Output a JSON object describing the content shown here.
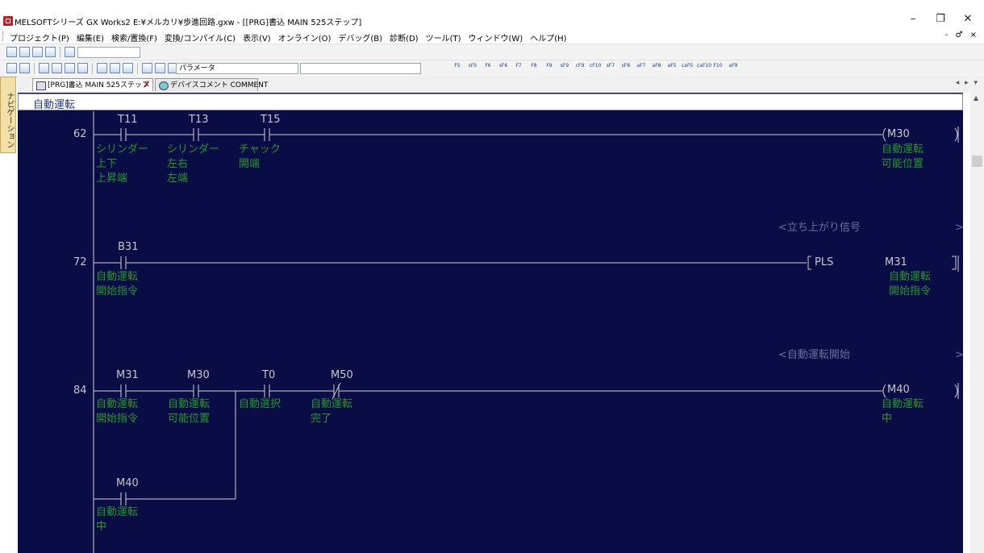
{
  "window": {
    "title": "MELSOFTシリーズ GX Works2 E:¥メルカリ¥歩進回路.gxw - [[PRG]書込 MAIN 525ステップ]",
    "controls": [
      "–",
      "❐",
      "✕"
    ]
  },
  "menu": {
    "items": [
      "プロジェクト(P)",
      "編集(E)",
      "検索/置換(F)",
      "変換/コンパイル(C)",
      "表示(V)",
      "オンライン(O)",
      "デバッグ(B)",
      "診断(D)",
      "ツール(T)",
      "ウィンドウ(W)",
      "ヘルプ(H)"
    ],
    "mdi_controls": "- ♂ ×"
  },
  "toolbar2": {
    "param_combo": "パラメータ"
  },
  "fkeys": [
    "F5",
    "sF5",
    "F6",
    "sF6",
    "F7",
    "F8",
    "F9",
    "sF9",
    "cF9",
    "cF10",
    "sF7",
    "sF8",
    "aF7",
    "aF8",
    "aF5",
    "caF5",
    "caF10",
    "F10",
    "aF9"
  ],
  "navigation": {
    "label": "ナビゲーション"
  },
  "tabs": [
    {
      "label": "[PRG]書込 MAIN 525ステップ",
      "active": true,
      "close": "✕"
    },
    {
      "label": "デバイスコメント COMMENT",
      "active": false
    }
  ],
  "tab_nav": "◂ ▸ ▾",
  "ladder": {
    "header_comment": "自動運転",
    "rungs": [
      {
        "step": "62",
        "contacts": [
          {
            "device": "T11",
            "comment": [
              "シリンダー",
              "上下",
              "上昇端"
            ]
          },
          {
            "device": "T13",
            "comment": [
              "シリンダー",
              "左右",
              "左端"
            ]
          },
          {
            "device": "T15",
            "comment": [
              "チャック",
              "開端"
            ]
          }
        ],
        "coil": {
          "device": "M30",
          "comment": [
            "自動運転",
            "可能位置"
          ]
        }
      },
      {
        "note": "<立ち上がり信号",
        "step": "72",
        "contacts": [
          {
            "device": "B31",
            "comment": [
              "自動運転",
              "開始指令"
            ]
          }
        ],
        "instruction": {
          "name": "PLS",
          "device": "M31",
          "comment": [
            "自動運転",
            "開始指令"
          ]
        }
      },
      {
        "note": "<自動運転開始",
        "step": "84",
        "contacts": [
          {
            "device": "M31",
            "comment": [
              "自動運転",
              "開始指令"
            ]
          },
          {
            "device": "M30",
            "comment": [
              "自動運転",
              "可能位置"
            ]
          },
          {
            "device": "T0",
            "comment": [
              "自動選択"
            ]
          },
          {
            "device": "M50",
            "comment": [
              "自動運転",
              "完了"
            ],
            "normally_closed": true
          }
        ],
        "branch": {
          "device": "M40",
          "comment": [
            "自動運転",
            "中"
          ]
        },
        "coil": {
          "device": "M40",
          "comment": [
            "自動運転",
            "中"
          ]
        }
      }
    ]
  }
}
